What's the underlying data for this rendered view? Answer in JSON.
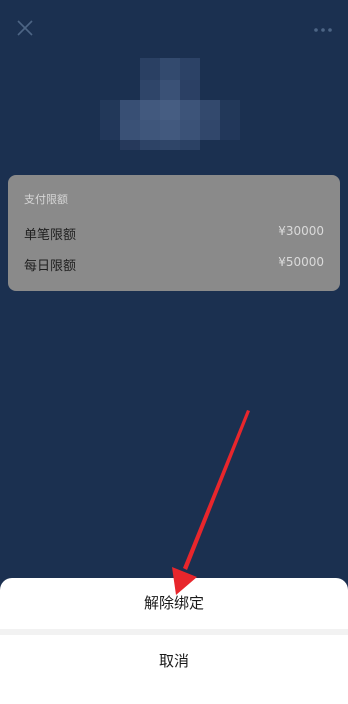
{
  "header": {
    "close_icon": "close-icon",
    "more_icon": "more-dots-icon"
  },
  "bank": {
    "logo": "pixelated-bank-logo"
  },
  "limits": {
    "title": "支付限额",
    "rows": [
      {
        "label": "单笔限额",
        "value": "¥30000"
      },
      {
        "label": "每日限额",
        "value": "¥50000"
      }
    ]
  },
  "action_sheet": {
    "unbind_label": "解除绑定",
    "cancel_label": "取消"
  },
  "colors": {
    "background": "#1b3050",
    "overlay_card": "#8a8a8a",
    "annotation_arrow": "#e8262c"
  }
}
